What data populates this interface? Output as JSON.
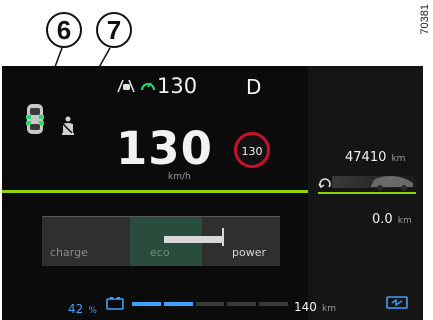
{
  "callouts": {
    "six": "6",
    "seven": "7"
  },
  "reference_code": "70381",
  "top_bar": {
    "cruise_speed": "130",
    "gear": "D"
  },
  "speed": {
    "value": "130",
    "unit": "km/h",
    "limit": "130"
  },
  "odometer": {
    "total": "47410",
    "total_unit": "km",
    "trip": "0.0",
    "trip_unit": "km"
  },
  "power_gauge": {
    "charge_label": "charge",
    "eco_label": "eco",
    "power_label": "power"
  },
  "battery": {
    "percent": "42",
    "percent_unit": "%",
    "range": "140",
    "range_unit": "km",
    "level_fraction": 0.42
  },
  "colors": {
    "accent_green": "#8fd400",
    "blue": "#3fa0ff",
    "limit_red": "#c8102e",
    "background": "#0b0b0b"
  },
  "icons": [
    "door-icon",
    "seatbelt-icon",
    "adaptive-cruise-icon",
    "car-silhouette-icon",
    "battery-icon",
    "regen-icon"
  ]
}
